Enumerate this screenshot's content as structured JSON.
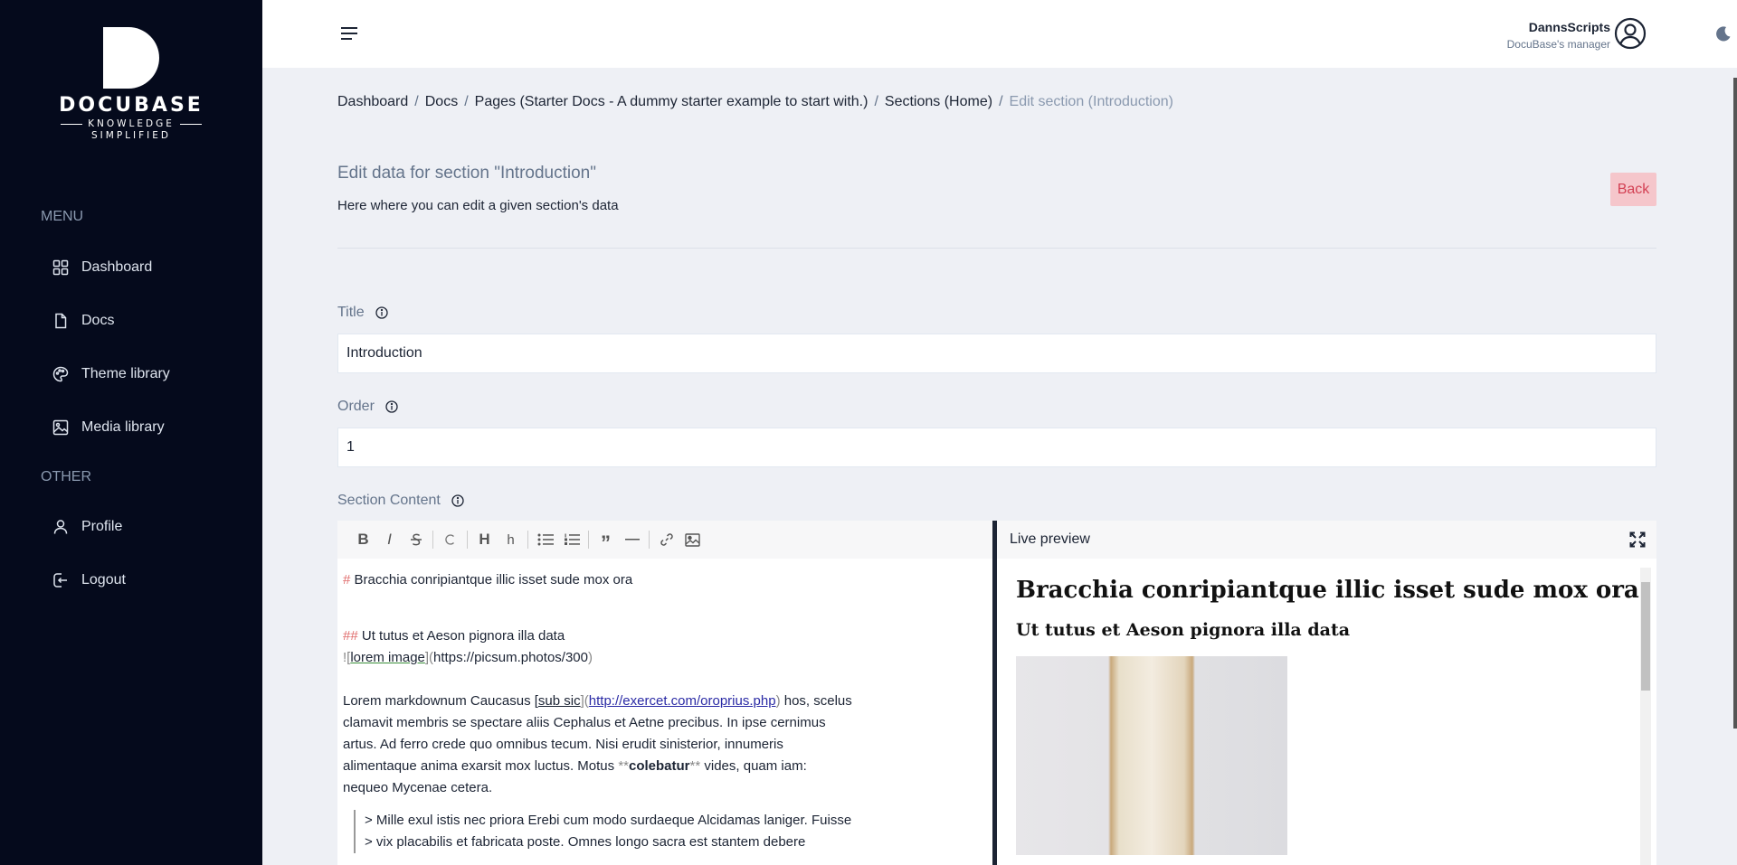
{
  "brand": {
    "name": "DOCUBASE",
    "tagline_1": "KNOWLEDGE",
    "tagline_2": "SIMPLIFIED"
  },
  "sidebar": {
    "menu_title": "MENU",
    "other_title": "OTHER",
    "items": [
      {
        "label": "Dashboard",
        "icon": "grid-icon"
      },
      {
        "label": "Docs",
        "icon": "file-icon"
      },
      {
        "label": "Theme library",
        "icon": "palette-icon"
      },
      {
        "label": "Media library",
        "icon": "image-icon"
      }
    ],
    "other_items": [
      {
        "label": "Profile",
        "icon": "user-icon"
      },
      {
        "label": "Logout",
        "icon": "logout-icon"
      }
    ]
  },
  "header": {
    "user_name": "DannsScripts",
    "user_role": "DocuBase's manager"
  },
  "breadcrumb": {
    "items": [
      "Dashboard",
      "Docs",
      "Pages (Starter Docs - A dummy starter example to start with.)",
      "Sections (Home)"
    ],
    "current": "Edit section (Introduction)",
    "separator": "/"
  },
  "page": {
    "title": "Edit data for section \"Introduction\"",
    "subtitle": "Here where you can edit a given section's data",
    "back_label": "Back"
  },
  "form": {
    "title_label": "Title",
    "title_value": "Introduction",
    "order_label": "Order",
    "order_value": "1",
    "content_label": "Section Content"
  },
  "editor": {
    "h1_marker": "#",
    "h1_text": "Bracchia conripiantque illic isset sude mox ora",
    "h2_marker": "##",
    "h2_text": "Ut tutus et Aeson pignora illa data",
    "img_prefix": "![",
    "img_alt": "lorem image",
    "img_mid": "](",
    "img_url": "https://picsum.photos/300",
    "img_suffix": ")",
    "para_start": "Lorem markdownum Caucasus [",
    "para_link_text": "sub sic",
    "para_link_mid": "](",
    "para_link_url": "http://exercet.com/oroprius.php",
    "para_link_end": ")",
    "para_after_link": " hos, scelus",
    "para_line2": "clamavit membris se spectare aliis Cephalus et Aetne precibus. In ipse cernimus",
    "para_line3": "artus. Ad ferro crede quo omnibus tecum. Nisi erudit sinisterior, innumeris",
    "para_line4_start": "alimentaque anima exarsit mox luctus. Motus ",
    "bold_marker_open": "**",
    "bold_text": "colebatur",
    "bold_marker_close": "**",
    "para_line4_end": " vides, quam iam:",
    "para_line5": "nequeo Mycenae cetera.",
    "quote_line1": "> Mille exul istis nec priora Erebi cum modo surdaeque Alcidamas laniger. Fuisse",
    "quote_line2": "> vix placabilis et fabricata poste. Omnes longo sacra est stantem debere"
  },
  "preview": {
    "title": "Live preview",
    "h1": "Bracchia conripiantque illic isset sude mox ora",
    "h2": "Ut tutus et Aeson pignora illa data"
  },
  "toolbar": {
    "bold": "B",
    "italic": "I",
    "heading": "H",
    "heading_small": "h",
    "quote": "”"
  }
}
